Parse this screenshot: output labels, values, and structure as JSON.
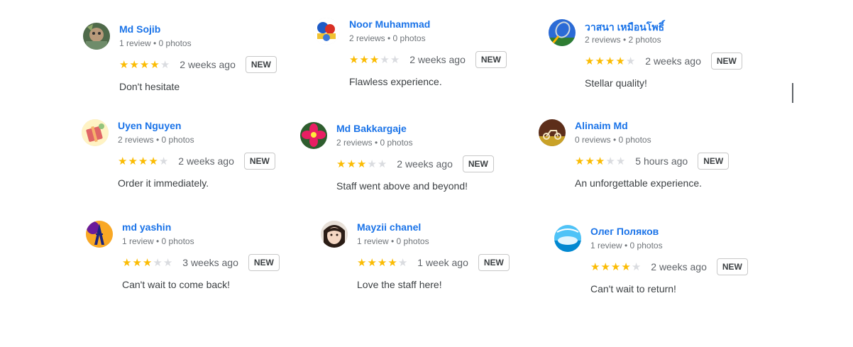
{
  "colors": {
    "name_link": "#1a73e8",
    "star_on": "#fbbc04",
    "star_off": "#dadce0",
    "meta_text": "#70757a"
  },
  "reviews": [
    {
      "name": "Md Sojib",
      "meta": "1 review • 0 photos",
      "rating": 4,
      "time": "2 weeks ago",
      "badge": "NEW",
      "text": "Don't hesitate",
      "avatar_icon": "painting-avatar-icon"
    },
    {
      "name": "Noor Muhammad",
      "meta": "2 reviews • 0 photos",
      "rating": 3,
      "time": "2 weeks ago",
      "badge": "NEW",
      "text": "Flawless experience.",
      "avatar_icon": "cartoon-avatar-icon"
    },
    {
      "name": "วาสนา เหมือนโพธิ์",
      "meta": "2 reviews • 2 photos",
      "rating": 4,
      "time": "2 weeks ago",
      "badge": "NEW",
      "text": "Stellar quality!",
      "avatar_icon": "badminton-racket-avatar-icon"
    },
    {
      "name": "Uyen Nguyen",
      "meta": "2 reviews • 0 photos",
      "rating": 4,
      "time": "2 weeks ago",
      "badge": "NEW",
      "text": "Order it immediately.",
      "avatar_icon": "gift-illustration-avatar-icon"
    },
    {
      "name": "Md Bakkargaje",
      "meta": "2 reviews • 0 photos",
      "rating": 3,
      "time": "2 weeks ago",
      "badge": "NEW",
      "text": "Staff went above and beyond!",
      "avatar_icon": "pink-flower-avatar-icon"
    },
    {
      "name": "Alinaim Md",
      "meta": "0 reviews • 0 photos",
      "rating": 3,
      "time": "5 hours ago",
      "badge": "NEW",
      "text": "An unforgettable experience.",
      "avatar_icon": "scooter-avatar-icon"
    },
    {
      "name": "md yashin",
      "meta": "1 review • 0 photos",
      "rating": 3,
      "time": "3 weeks ago",
      "badge": "NEW",
      "text": "Can't wait to come back!",
      "avatar_icon": "eiffel-tower-avatar-icon"
    },
    {
      "name": "Mayzii chanel",
      "meta": "1 review • 0 photos",
      "rating": 4,
      "time": "1 week ago",
      "badge": "NEW",
      "text": "Love the staff here!",
      "avatar_icon": "girl-portrait-avatar-icon"
    },
    {
      "name": "Олег Поляков",
      "meta": "1 review • 0 photos",
      "rating": 4,
      "time": "2 weeks ago",
      "badge": "NEW",
      "text": "Can't wait to return!",
      "avatar_icon": "pool-avatar-icon"
    }
  ]
}
